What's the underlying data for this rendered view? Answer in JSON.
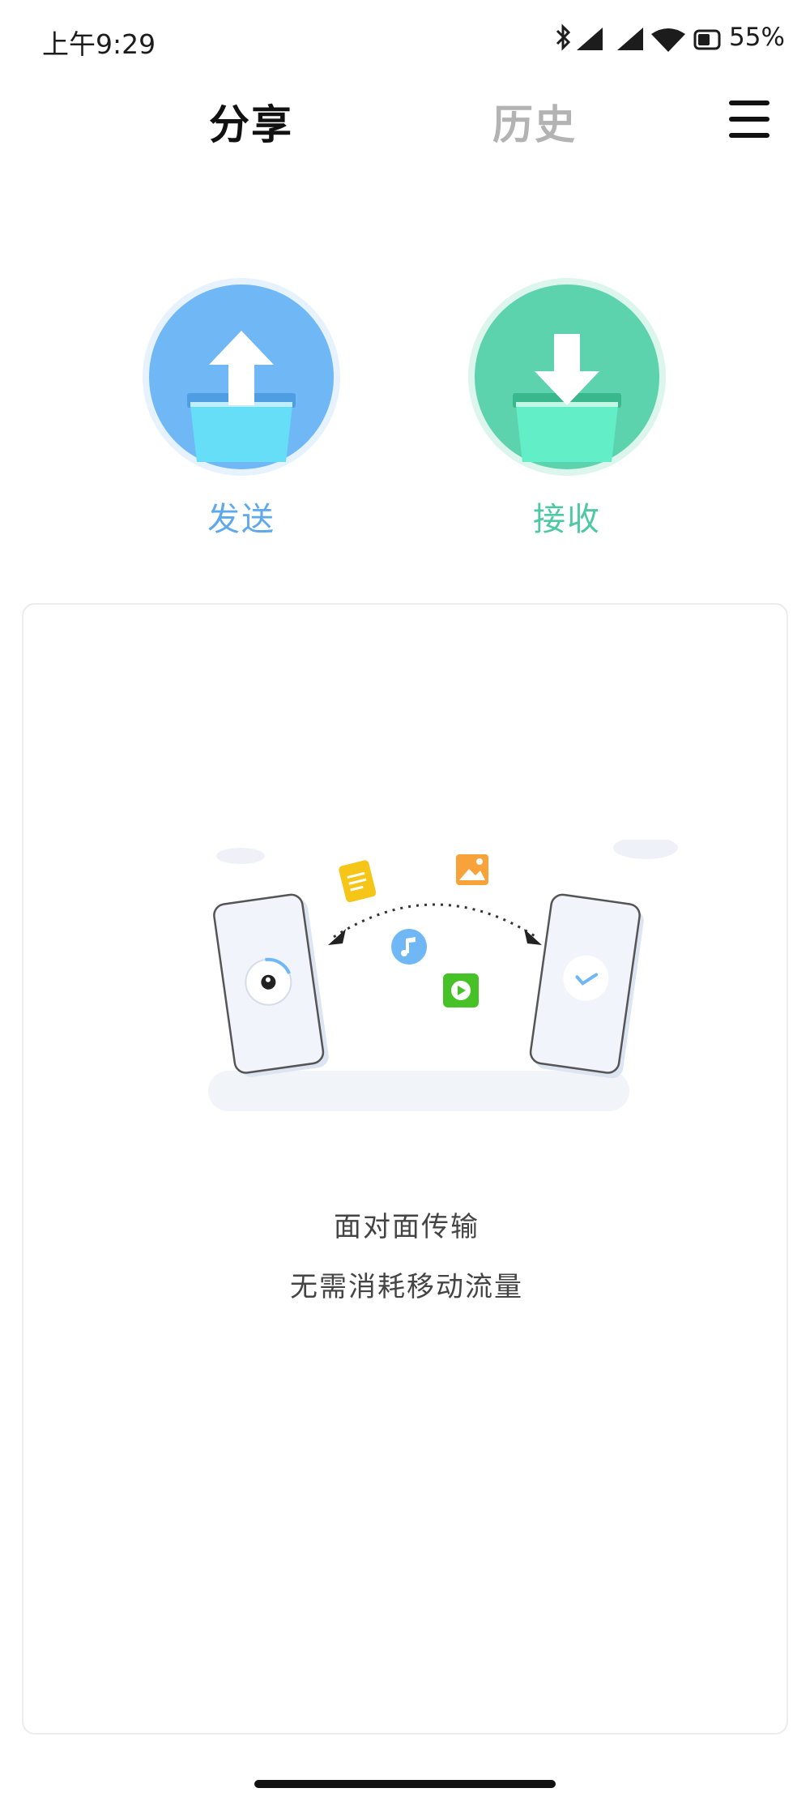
{
  "status_bar": {
    "time": "上午9:29",
    "battery_percent": "55%",
    "icons": [
      "bluetooth-icon",
      "signal-icon",
      "signal-icon",
      "wifi-icon",
      "battery-icon"
    ]
  },
  "tabs": [
    {
      "label": "分享",
      "active": true
    },
    {
      "label": "历史",
      "active": false
    }
  ],
  "menu_icon": "hamburger-menu-icon",
  "actions": {
    "send": {
      "label": "发送",
      "icon": "upload-folder-icon",
      "color": "#6fb8f5"
    },
    "receive": {
      "label": "接收",
      "icon": "download-folder-icon",
      "color": "#5cd3ad"
    }
  },
  "card": {
    "illustration_icons": [
      "phone-icon",
      "document-icon",
      "image-icon",
      "music-icon",
      "video-icon",
      "checkmark-icon"
    ],
    "line1": "面对面传输",
    "line2": "无需消耗移动流量"
  },
  "colors": {
    "active_tab": "#111111",
    "inactive_tab": "#b3b3b3",
    "send_accent": "#5ea9ec",
    "receive_accent": "#4ec9a0"
  }
}
